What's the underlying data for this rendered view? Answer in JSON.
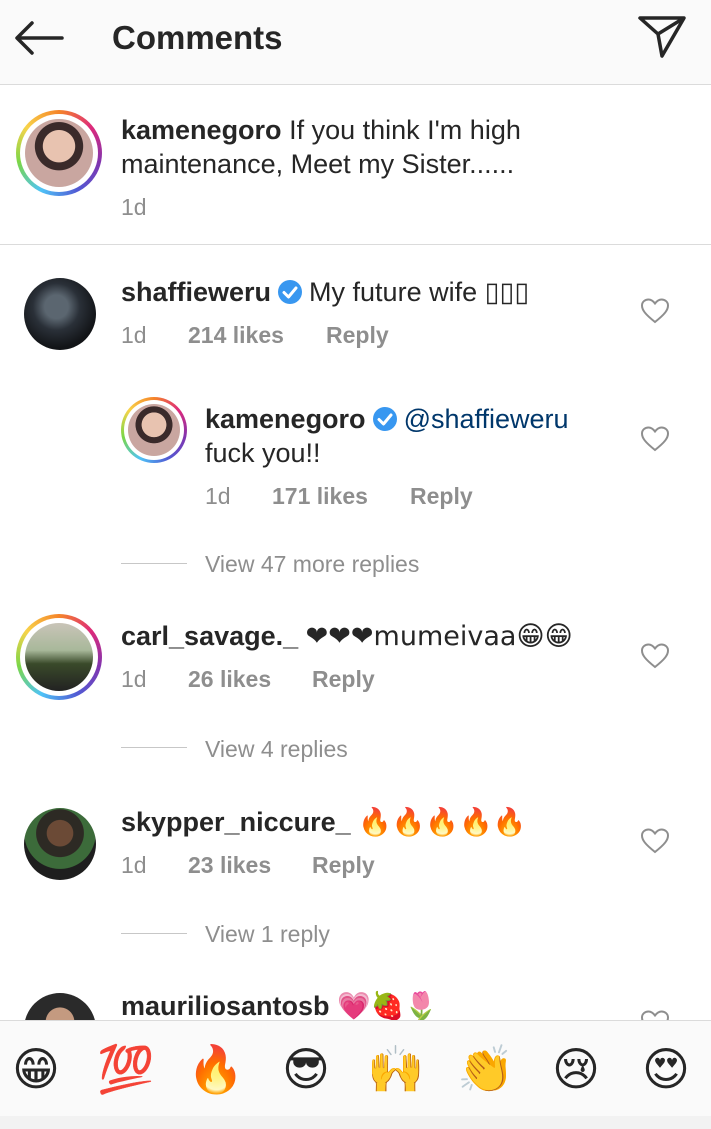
{
  "header": {
    "title": "Comments"
  },
  "caption": {
    "username": "kamenegoro",
    "text": "If you think I'm high maintenance, Meet my Sister......",
    "line1": "If you think I'm high",
    "line2": "maintenance, Meet my Sister......",
    "time": "1d"
  },
  "comments": [
    {
      "username": "shaffieweru",
      "verified": true,
      "text": "My future wife",
      "emoji": "▯▯▯",
      "time": "1d",
      "likes": "214 likes",
      "reply": "Reply"
    },
    {
      "username": "carl_savage._",
      "text": "❤❤❤mumeivaa😁😁",
      "time": "1d",
      "likes": "26 likes",
      "reply": "Reply",
      "view_replies": "View 4 replies"
    },
    {
      "username": "skypper_niccure_",
      "text": "🔥🔥🔥🔥🔥",
      "time": "1d",
      "likes": "23 likes",
      "reply": "Reply",
      "view_replies": "View 1 reply"
    },
    {
      "username": "mauriliosantosb",
      "text": "💗🍓🌷"
    }
  ],
  "reply": {
    "username": "kamenegoro",
    "verified": true,
    "mention": "@shaffieweru",
    "text": "fuck you!!",
    "time": "1d",
    "likes": "171 likes",
    "reply": "Reply"
  },
  "view_more_replies": "View 47 more replies",
  "emoji_bar": [
    "😁",
    "💯",
    "🔥",
    "😎",
    "🙌",
    "👏",
    "😢",
    "😍"
  ],
  "colors": {
    "verified": "#3897f0",
    "mention": "#00376b",
    "secondary_text": "#8e8e8e"
  }
}
